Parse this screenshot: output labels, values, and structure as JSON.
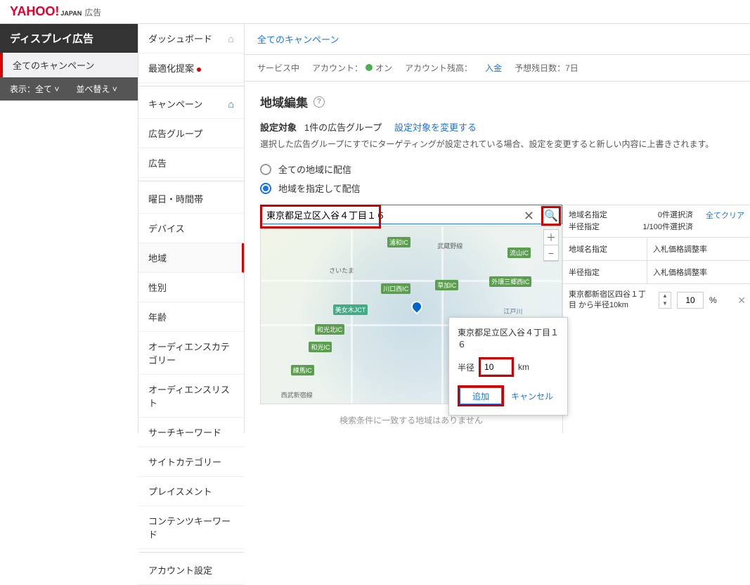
{
  "header": {
    "logo_main": "YAHOO!",
    "logo_sub": "JAPAN",
    "logo_ad": "広告"
  },
  "col1": {
    "title": "ディスプレイ広告",
    "all_campaign": "全てのキャンペーン",
    "display_label": "表示：全て",
    "sort_label": "並べ替え"
  },
  "nav": {
    "dashboard": "ダッシュボード",
    "optimize": "最適化提案",
    "campaign": "キャンペーン",
    "adgroup": "広告グループ",
    "ads": "広告",
    "daytime": "曜日・時間帯",
    "device": "デバイス",
    "region": "地域",
    "gender": "性別",
    "age": "年齢",
    "aud_cat": "オーディエンスカテゴリー",
    "aud_list": "オーディエンスリスト",
    "search_kw": "サーチキーワード",
    "site_cat": "サイトカテゴリー",
    "placement": "プレイスメント",
    "content_kw": "コンテンツキーワード",
    "account": "アカウント設定"
  },
  "crumbs": "全てのキャンペーン",
  "status": {
    "service": "サービス中",
    "account_label": "アカウント：",
    "on": "オン",
    "balance_label": "アカウント残高：",
    "deposit": "入金",
    "forecast": "予想残日数：7日"
  },
  "content": {
    "h2": "地域編集",
    "target_label": "設定対象",
    "target_value": "1件の広告グループ",
    "change_link": "設定対象を変更する",
    "note": "選択した広告グループにすでにターゲティングが設定されている場合、設定を変更すると新しい内容に上書きされます。",
    "radio_all": "全ての地域に配信",
    "radio_specific": "地域を指定して配信",
    "search_value": "東京都足立区入谷４丁目１６",
    "popup": {
      "title": "東京都足立区入谷４丁目１６",
      "radius_label": "半径",
      "radius_value": "10",
      "unit": "km",
      "add": "追加",
      "cancel": "キャンセル"
    },
    "map_ics": [
      "浦和IC",
      "流山IC",
      "さいたま",
      "川口西IC",
      "草加IC",
      "外環三郷西IC",
      "美女木JCT",
      "江戸川",
      "和光北IC",
      "武蔵野線",
      "和光IC",
      "練馬IC",
      "西武新宿線"
    ],
    "no_result": "検索条件に一致する地域はありません"
  },
  "panel": {
    "head_l1": "地域名指定",
    "head_l2": "半径指定",
    "head_r1": "0件選択済",
    "head_r2": "1/100件選択済",
    "clear": "全てクリア",
    "row1_l": "地域名指定",
    "row1_r": "入札価格調整率",
    "row2_l": "半径指定",
    "row2_r": "入札価格調整率",
    "item_text": "東京都新宿区四谷１丁目 から半径10km",
    "item_value": "10",
    "pct": "%"
  }
}
